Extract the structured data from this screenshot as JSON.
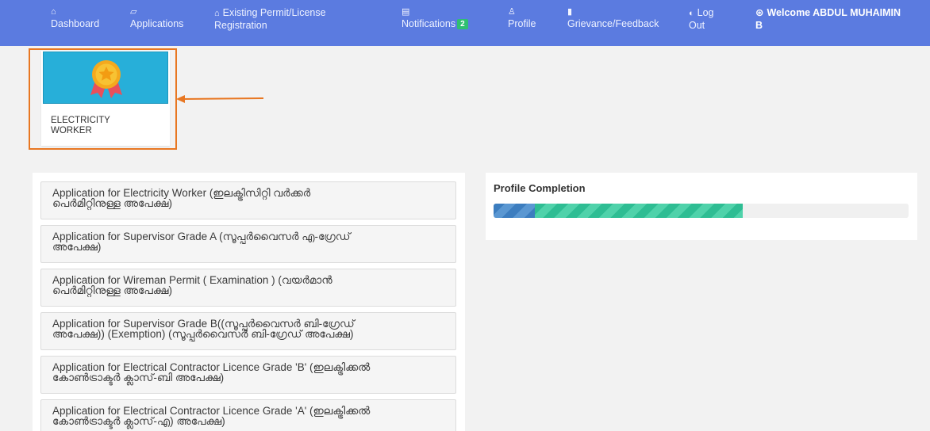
{
  "nav": {
    "dashboard": {
      "icon": "⌂",
      "label": "Dashboard"
    },
    "applications": {
      "icon": "▱",
      "label": "Applications"
    },
    "existing": {
      "icon": "⌂",
      "line1": "Existing Permit/License",
      "line2": "Registration"
    },
    "notifications": {
      "icon": "▤",
      "label": "Notifications",
      "badge": "2"
    },
    "profile": {
      "icon": "♙",
      "label": "Profile"
    },
    "grievance": {
      "icon": "▮",
      "label": "Grievance/Feedback"
    },
    "logout": {
      "icon": "◐",
      "line1": "Log",
      "line2": "Out"
    },
    "welcome": {
      "icon": "⊛",
      "line1": "Welcome ABDUL MUHAIMIN",
      "line2": "B"
    }
  },
  "tile": {
    "label_line1": "ELECTRICITY",
    "label_line2": "WORKER",
    "icon": "award-medal-icon"
  },
  "applications": [
    {
      "line1": "Application for Electricity Worker (ഇലക്ട്രിസിറ്റി വർക്കർ",
      "line2": "പെർമിറ്റിനുള്ള അപേക്ഷ)"
    },
    {
      "line1": "Application for Supervisor Grade A (സൂപ്പർവൈസർ എ-ഗ്രേഡ്",
      "line2": "അപേക്ഷ)"
    },
    {
      "line1": "Application for Wireman Permit ( Examination ) (വയർമാൻ",
      "line2": "പെർമിറ്റിനുള്ള അപേക്ഷ)"
    },
    {
      "line1": "Application for Supervisor Grade B((സൂപ്പർവൈസർ ബി-ഗ്രേഡ്",
      "line2": "അപേക്ഷ)) (Exemption) (സൂപ്പർവൈസർ ബി-ഗ്രേഡ് അപേക്ഷ)"
    },
    {
      "line1": "Application for Electrical Contractor Licence Grade 'B' (ഇലക്ട്രിക്കൽ",
      "line2": "കോൺട്രാക്ടർ ക്ലാസ്-ബി അപേക്ഷ)"
    },
    {
      "line1": "Application for Electrical Contractor Licence Grade 'A' (ഇലക്ട്രിക്കൽ",
      "line2": "കോൺട്രാക്ടർ ക്ലാസ്-എ) അപേക്ഷ)"
    }
  ],
  "profile_completion": {
    "title": "Profile Completion",
    "progress_fraction": 0.6,
    "segments": [
      {
        "fraction": 0.1,
        "color": "#3c7dbf"
      },
      {
        "fraction": 0.5,
        "color": "#2ebd93"
      }
    ]
  },
  "colors": {
    "navbar": "#5b7be0",
    "highlight": "#e87722",
    "tile_banner": "#27afd9",
    "badge": "#2fbf71"
  }
}
